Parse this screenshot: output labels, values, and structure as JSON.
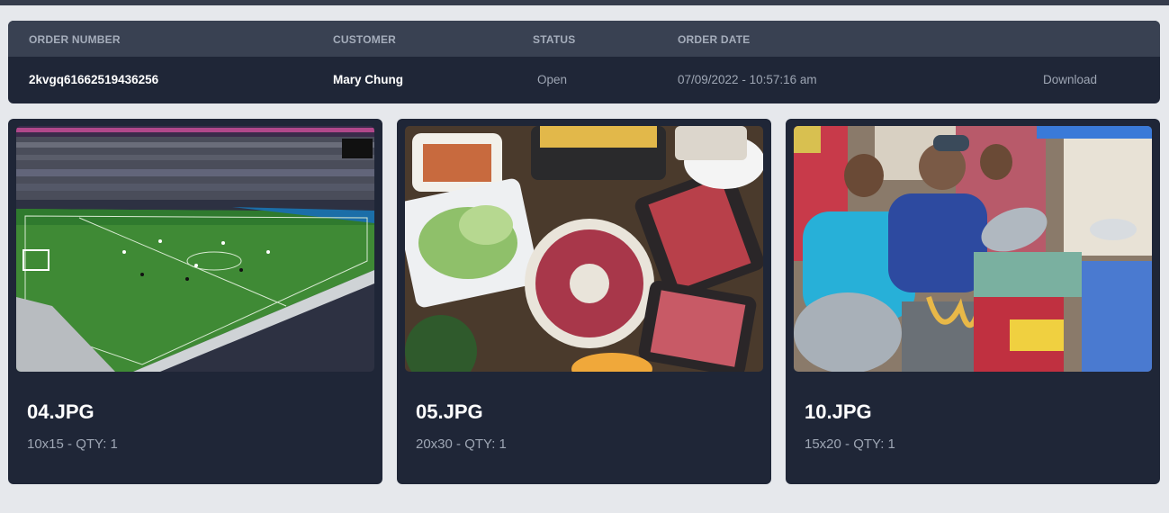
{
  "table": {
    "headers": {
      "order_number": "ORDER NUMBER",
      "customer": "CUSTOMER",
      "status": "STATUS",
      "order_date": "ORDER DATE"
    },
    "row": {
      "order_number": "2kvgq61662519436256",
      "customer": "Mary Chung",
      "status": "Open",
      "order_date": "07/09/2022 - 10:57:16 am",
      "action": "Download"
    }
  },
  "photos": [
    {
      "filename": "04.JPG",
      "details": "10x15 - QTY: 1",
      "image": "football-stadium"
    },
    {
      "filename": "05.JPG",
      "details": "20x30 - QTY: 1",
      "image": "raw-meat-barbecue-table"
    },
    {
      "filename": "10.JPG",
      "details": "15x20 - QTY: 1",
      "image": "street-food-noodle-stall"
    }
  ],
  "colors": {
    "page_bg": "#e6e8ec",
    "panel_bg": "#1f2637",
    "header_bg": "#394152",
    "muted_text": "#9ea6b4"
  }
}
